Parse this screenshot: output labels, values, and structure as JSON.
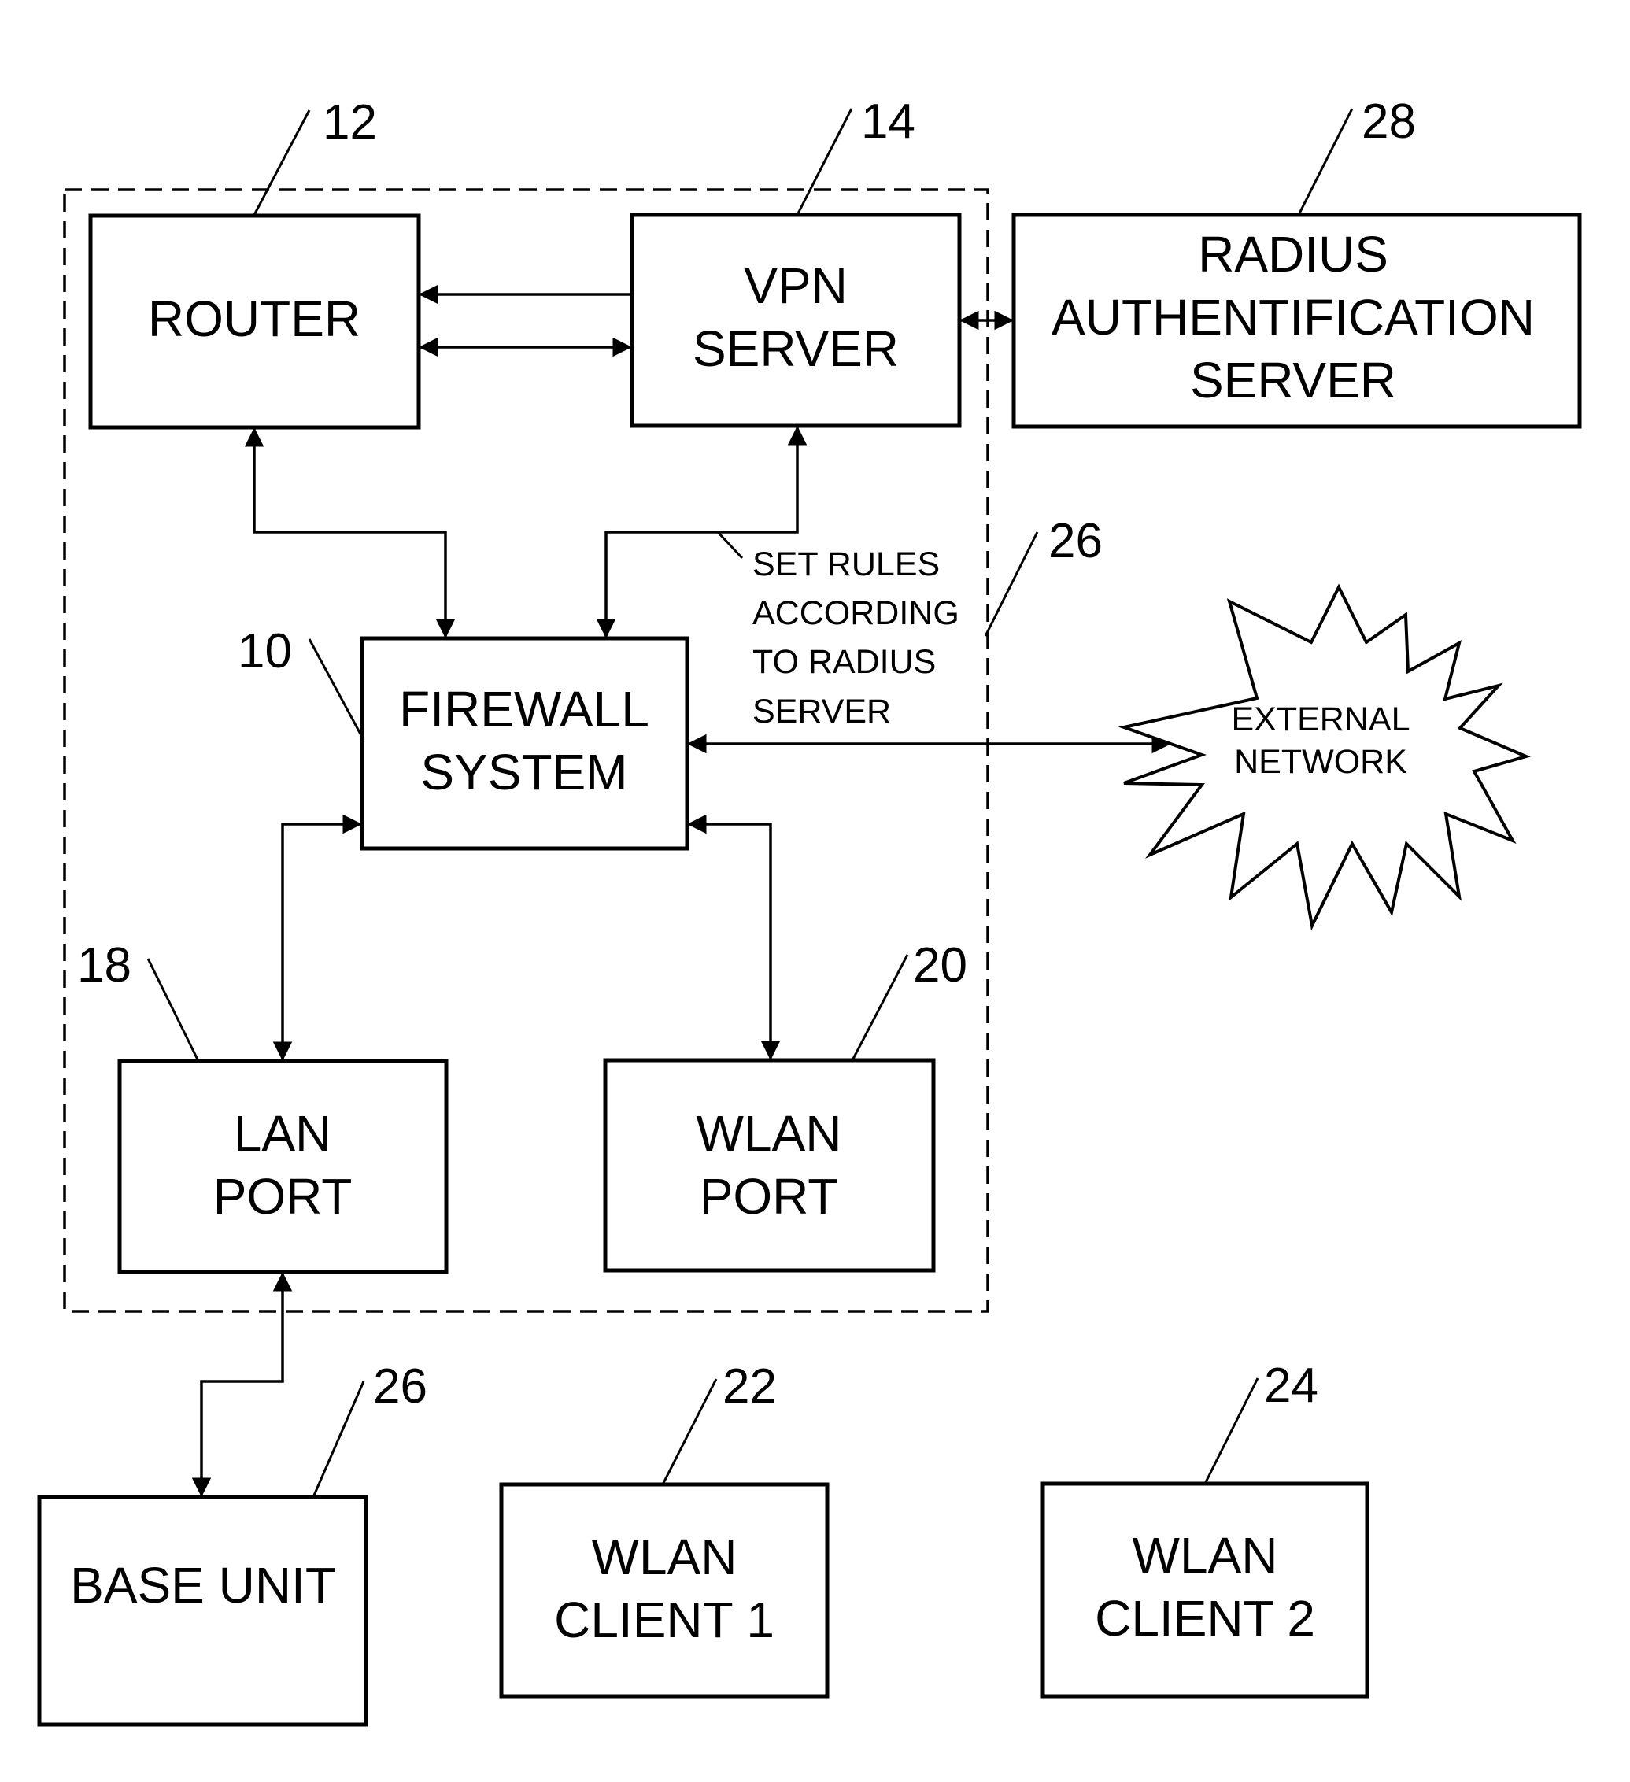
{
  "diagram": {
    "type": "network block diagram",
    "group": {
      "ref": "26",
      "style": "dashed boundary"
    },
    "blocks": {
      "router": {
        "ref": "12",
        "lines": [
          "ROUTER"
        ]
      },
      "vpn": {
        "ref": "14",
        "lines": [
          "VPN",
          "SERVER"
        ]
      },
      "radius": {
        "ref": "28",
        "lines": [
          "RADIUS",
          "AUTHENTIFICATION",
          "SERVER"
        ]
      },
      "firewall": {
        "ref": "10",
        "lines": [
          "FIREWALL",
          "SYSTEM"
        ]
      },
      "lan_port": {
        "ref": "18",
        "lines": [
          "LAN",
          "PORT"
        ]
      },
      "wlan_port": {
        "ref": "20",
        "lines": [
          "WLAN",
          "PORT"
        ]
      },
      "base_unit": {
        "ref": "26",
        "lines": [
          "BASE UNIT"
        ]
      },
      "client1": {
        "ref": "22",
        "lines": [
          "WLAN",
          "CLIENT 1"
        ]
      },
      "client2": {
        "ref": "24",
        "lines": [
          "WLAN",
          "CLIENT 2"
        ]
      },
      "external": {
        "lines": [
          "EXTERNAL",
          "NETWORK"
        ]
      }
    },
    "annotation": {
      "lines": [
        "SET RULES",
        "ACCORDING",
        "TO RADIUS",
        "SERVER"
      ]
    },
    "connections": [
      {
        "from": "vpn",
        "to": "router",
        "direction": "one-way"
      },
      {
        "from": "router",
        "to": "vpn",
        "direction": "bidirectional"
      },
      {
        "from": "vpn",
        "to": "radius",
        "direction": "bidirectional"
      },
      {
        "from": "router",
        "to": "firewall",
        "direction": "bidirectional"
      },
      {
        "from": "vpn",
        "to": "firewall",
        "direction": "bidirectional"
      },
      {
        "from": "firewall",
        "to": "external",
        "direction": "bidirectional"
      },
      {
        "from": "firewall",
        "to": "lan_port",
        "direction": "bidirectional"
      },
      {
        "from": "firewall",
        "to": "wlan_port",
        "direction": "bidirectional"
      },
      {
        "from": "lan_port",
        "to": "base_unit",
        "direction": "bidirectional"
      }
    ]
  }
}
